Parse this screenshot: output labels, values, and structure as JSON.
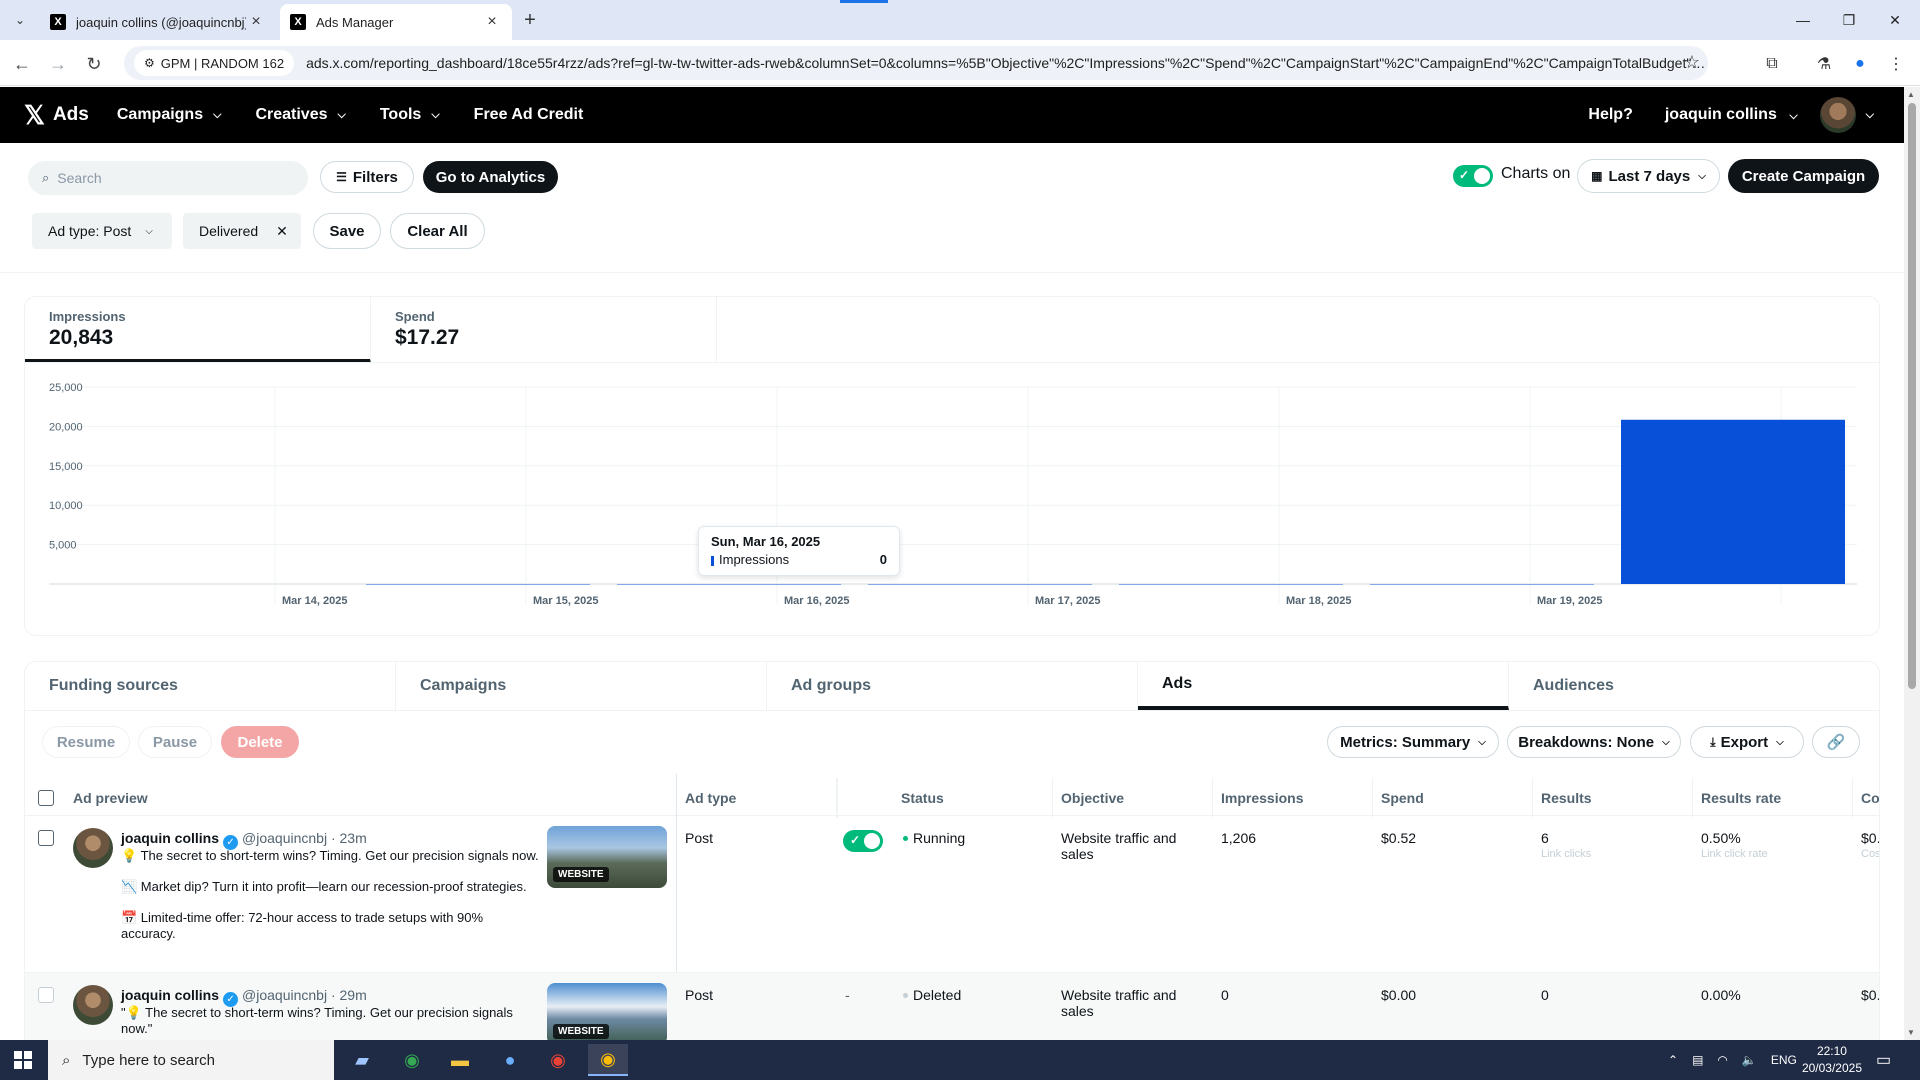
{
  "browser": {
    "tabs": [
      {
        "title": "joaquin collins (@joaquincnbj) / X"
      },
      {
        "title": "Ads Manager"
      }
    ],
    "site_chip": "GPM | RANDOM 162",
    "url": "ads.x.com/reporting_dashboard/18ce55r4rzz/ads?ref=gl-tw-tw-twitter-ads-rweb&columnSet=0&columns=%5B\"Objective\"%2C\"Impressions\"%2C\"Spend\"%2C\"CampaignStart\"%2C\"CampaignEnd\"%2C\"CampaignTotalBudget\"%2C\"..."
  },
  "header": {
    "brand": "Ads",
    "nav": [
      "Campaigns",
      "Creatives",
      "Tools",
      "Free Ad Credit"
    ],
    "help": "Help?",
    "user": "joaquin collins"
  },
  "toolbar": {
    "search_placeholder": "Search",
    "filters": "Filters",
    "go_analytics": "Go to Analytics",
    "charts_on": "Charts on",
    "date_range": "Last 7 days",
    "create_campaign": "Create Campaign",
    "chips": [
      "Ad type: Post",
      "Delivered"
    ],
    "save": "Save",
    "clear_all": "Clear All"
  },
  "metrics": [
    {
      "label": "Impressions",
      "value": "20,843"
    },
    {
      "label": "Spend",
      "value": "$17.27"
    }
  ],
  "chart_data": {
    "type": "bar",
    "categories": [
      "Mar 14, 2025",
      "Mar 15, 2025",
      "Mar 16, 2025",
      "Mar 17, 2025",
      "Mar 18, 2025",
      "Mar 19, 2025"
    ],
    "series": [
      {
        "name": "Impressions",
        "values": [
          0,
          0,
          0,
          0,
          0,
          20843
        ]
      }
    ],
    "ylim": [
      0,
      25000
    ],
    "yticks": [
      "25,000",
      "20,000",
      "15,000",
      "10,000",
      "5,000"
    ],
    "ytick_values": [
      25000,
      20000,
      15000,
      10000,
      5000
    ],
    "grid": true,
    "color": "#0950d9",
    "tooltip": {
      "date": "Sun, Mar 16, 2025",
      "series": "Impressions",
      "value": "0"
    }
  },
  "levels": [
    "Funding sources",
    "Campaigns",
    "Ad groups",
    "Ads",
    "Audiences"
  ],
  "actions": {
    "resume": "Resume",
    "pause": "Pause",
    "delete": "Delete",
    "metrics": "Metrics: Summary",
    "breakdowns": "Breakdowns: None",
    "export": "Export"
  },
  "columns": [
    "Ad preview",
    "Ad type",
    "Status",
    "Objective",
    "Impressions",
    "Spend",
    "Results",
    "Results rate",
    "Co"
  ],
  "rows": [
    {
      "name": "joaquin collins",
      "handle": "@joaquincnbj",
      "time": "· 23m",
      "text": [
        "💡 The secret to short-term wins? Timing. Get our precision signals now.",
        "📉 Market dip? Turn it into profit—learn our recession-proof strategies.",
        "📅 Limited-time offer: 72-hour access to trade setups with 90% accuracy."
      ],
      "badge": "WEBSITE",
      "ad_type": "Post",
      "status": "Running",
      "objective": "Website traffic and sales",
      "impressions": "1,206",
      "spend": "$0.52",
      "results": "6",
      "results_sub": "Link clicks",
      "results_rate": "0.50%",
      "results_rate_sub": "Link click rate",
      "cost": "$0.",
      "cost_sub": "Cos"
    },
    {
      "name": "joaquin collins",
      "handle": "@joaquincnbj",
      "time": "· 29m",
      "text": [
        "\"💡 The secret to short-term wins? Timing. Get our precision signals now.\""
      ],
      "badge": "WEBSITE",
      "ad_type": "Post",
      "toggle": "-",
      "status": "Deleted",
      "objective": "Website traffic and sales",
      "impressions": "0",
      "spend": "$0.00",
      "results": "0",
      "results_rate": "0.00%",
      "cost": "$0."
    }
  ],
  "taskbar": {
    "search_placeholder": "Type here to search",
    "lang": "ENG",
    "time": "22:10",
    "date": "20/03/2025"
  }
}
